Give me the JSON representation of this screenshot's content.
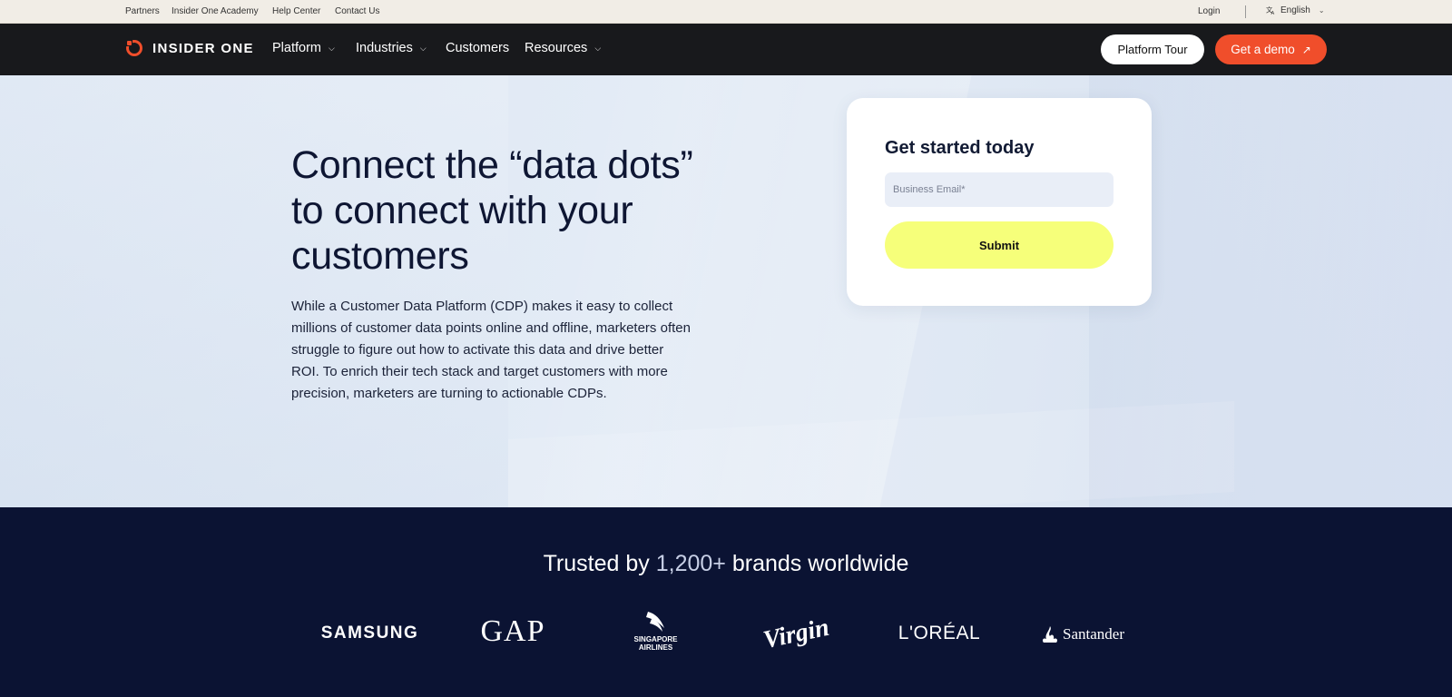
{
  "utility": {
    "links": [
      "Partners",
      "Insider One Academy",
      "Help Center",
      "Contact Us"
    ],
    "login": "Login",
    "language": "English"
  },
  "nav": {
    "logo_text": "INSIDER ONE",
    "items": [
      "Platform",
      "Industries",
      "Customers",
      "Resources"
    ],
    "tour_label": "Platform Tour",
    "demo_label": "Get a demo"
  },
  "hero": {
    "title": "Connect the “data dots” to connect with your customers",
    "body": "While a Customer Data Platform (CDP) makes it easy to collect millions of customer data points online and offline, marketers often struggle to figure out how to activate this data and drive better ROI. To enrich their tech stack and target customers with more precision, marketers are turning to actionable CDPs."
  },
  "form": {
    "title": "Get started today",
    "email_placeholder": "Business Email*",
    "email_value": "",
    "submit_label": "Submit"
  },
  "trusted": {
    "prefix": "Trusted by",
    "highlight": "1,200+",
    "suffix": "brands worldwide",
    "brands": [
      "SAMSUNG",
      "GAP",
      "SINGAPORE AIRLINES",
      "Virgin",
      "L'ORÉAL",
      "Santander"
    ]
  },
  "colors": {
    "accent": "#f04e2b",
    "submit": "#f6ff7a",
    "navy": "#0b1333",
    "nav_bg": "#18191c"
  }
}
